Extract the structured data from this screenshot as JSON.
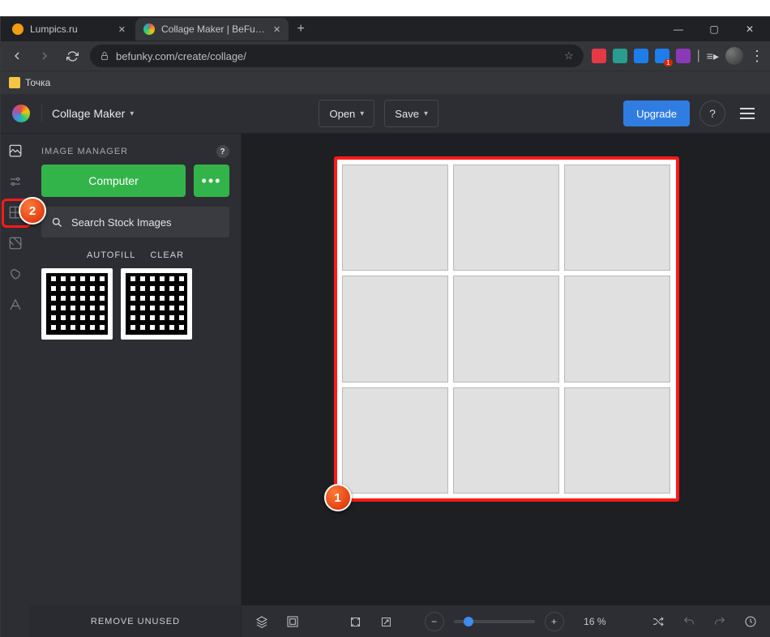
{
  "browser": {
    "tabs": [
      {
        "title": "Lumpics.ru",
        "active": false,
        "favicon": "#f39c12"
      },
      {
        "title": "Collage Maker | BeFunky: Create",
        "active": true,
        "favicon": "#9b59b6"
      }
    ],
    "url": "befunky.com/create/collage/",
    "bookmark": "Точка"
  },
  "app": {
    "mode": "Collage Maker",
    "open": "Open",
    "save": "Save",
    "upgrade": "Upgrade",
    "panel": {
      "title": "IMAGE MANAGER",
      "computer": "Computer",
      "search": "Search Stock Images",
      "autofill": "AUTOFILL",
      "clear": "CLEAR",
      "remove": "REMOVE UNUSED"
    },
    "zoom": "16 %",
    "callouts": {
      "one": "1",
      "two": "2"
    }
  }
}
